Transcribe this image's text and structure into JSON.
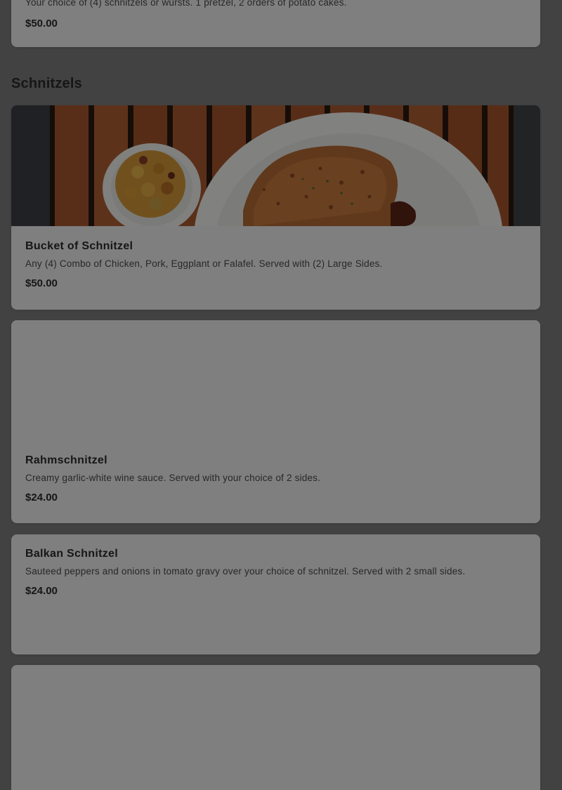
{
  "prev_item": {
    "desc": "Your choice of (4) schnitzels or wursts. 1 pretzel, 2 orders of potato cakes.",
    "price": "$50.00"
  },
  "section": {
    "title": "Schnitzels"
  },
  "items": [
    {
      "name": "Bucket of Schnitzel",
      "desc": "Any (4) Combo of Chicken, Pork, Eggplant or Falafel. Served with (2) Large Sides.",
      "price": "$50.00"
    },
    {
      "name": "Rahmschnitzel",
      "desc": "Creamy garlic-white wine sauce. Served with your choice of 2 sides.",
      "price": "$24.00"
    },
    {
      "name": "Balkan Schnitzel",
      "desc": "Sauteed peppers and onions in tomato gravy over your choice of schnitzel. Served with 2 small sides.",
      "price": "$24.00"
    }
  ],
  "colors": {
    "overlay": "#000000",
    "card": "#f0f0f0",
    "text": "#2b2b2b"
  }
}
